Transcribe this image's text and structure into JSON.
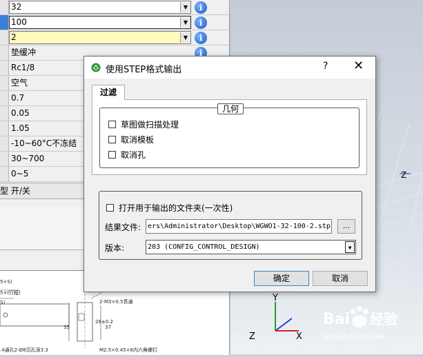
{
  "param_rows": [
    {
      "value": "32",
      "style": "combo",
      "info": true
    },
    {
      "value": "100",
      "style": "combo-dark",
      "info": true,
      "active": true
    },
    {
      "value": "2",
      "style": "combo-yellow",
      "info": true
    },
    {
      "value": "垫缓冲",
      "style": "plain",
      "info": true
    },
    {
      "value": "Rc1/8",
      "style": "plain",
      "info": false
    },
    {
      "value": "空气",
      "style": "plain",
      "info": false
    },
    {
      "value": "0.7",
      "style": "plain",
      "info": false
    },
    {
      "value": "0.05",
      "style": "plain",
      "info": false
    },
    {
      "value": "1.05",
      "style": "plain",
      "info": false
    },
    {
      "value": "-10~60°C不冻结",
      "style": "plain",
      "info": false
    },
    {
      "value": "30~700",
      "style": "plain",
      "info": false
    },
    {
      "value": "0~5",
      "style": "plain",
      "info": false
    }
  ],
  "switch_row": {
    "label": "型 开/关"
  },
  "drawing": {
    "labels": [
      "5+S)",
      "5+(行程)",
      "S)",
      "2-M3×0.5贯通",
      "35",
      "28±0.2",
      "37",
      ".4通孔2-Ø8沉孔深3.3",
      "M2.5×0.45×6内六角螺钉"
    ]
  },
  "viewport": {
    "axis_z_side": "Z",
    "triad": {
      "y": "Y",
      "z": "Z",
      "x": "X"
    }
  },
  "dialog": {
    "title": "使用STEP格式输出",
    "help": "?",
    "close": "✕",
    "tab_filter": "过滤",
    "geometry_group": {
      "legend": "几何",
      "checkboxes": [
        {
          "label": "草图做扫描处理",
          "checked": false
        },
        {
          "label": "取消模板",
          "checked": false
        },
        {
          "label": "取消孔",
          "checked": false
        }
      ]
    },
    "output": {
      "open_folder": {
        "label": "打开用于输出的文件夹(一次性)",
        "checked": false
      },
      "result_file_label": "结果文件:",
      "result_file_value": "ers\\Administrator\\Desktop\\WGWO1-32-100-2.stp",
      "browse_label": "...",
      "version_label": "版本:",
      "version_value": "203 (CONFIG_CONTROL_DESIGN)"
    },
    "ok_label": "确定",
    "cancel_label": "取消"
  },
  "watermark": {
    "brand": "Bai经验",
    "site": "jingyan.baidu.com"
  },
  "colors": {
    "info_blue": "#1759c7",
    "active_blue": "#3c7fd6",
    "yellow_field": "#fffbbf",
    "axis_y": "#20a020",
    "axis_z": "#1b3fd1",
    "axis_x": "#d12020"
  }
}
